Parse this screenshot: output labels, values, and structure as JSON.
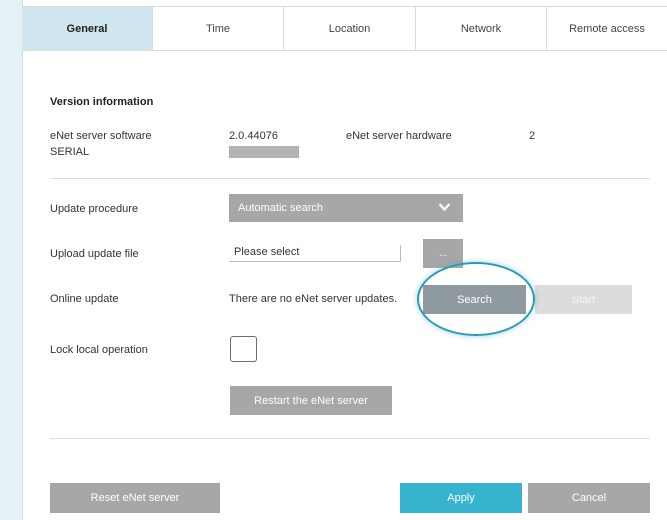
{
  "tabs": [
    "General",
    "Time",
    "Location",
    "Network",
    "Remote access"
  ],
  "version": {
    "heading": "Version information",
    "software_label": "eNet server software",
    "software_value": "2.0.44076",
    "hardware_label": "eNet server hardware",
    "hardware_value": "2",
    "serial_label": "SERIAL"
  },
  "update_procedure": {
    "label": "Update procedure",
    "value": "Automatic search"
  },
  "upload": {
    "label": "Upload update file",
    "value": "Please select",
    "button": "..."
  },
  "online_update": {
    "label": "Online update",
    "status": "There are no eNet server updates.",
    "search_button": "Search",
    "start_button": "Start"
  },
  "lock": {
    "label": "Lock local operation"
  },
  "restart_button": "Restart the eNet server",
  "footer": {
    "reset": "Reset eNet server",
    "apply": "Apply",
    "cancel": "Cancel"
  },
  "colors": {
    "accent": "#36b4cf",
    "active_tab": "#cfe6ee",
    "button_grey": "#a7a7a7",
    "background": "#e5f1f5"
  }
}
